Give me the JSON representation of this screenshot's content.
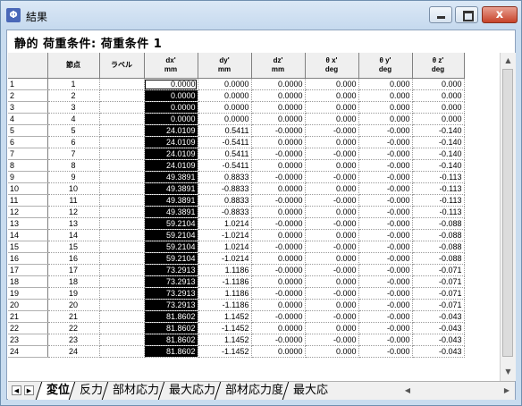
{
  "window": {
    "title": "結果",
    "icon": "app-icon",
    "close_label": "x"
  },
  "header": {
    "title": "静的 荷重条件: 荷重条件 1"
  },
  "table": {
    "columns": [
      {
        "label": "",
        "unit": ""
      },
      {
        "label": "節点",
        "unit": ""
      },
      {
        "label": "ラベル",
        "unit": ""
      },
      {
        "label": "dx'",
        "unit": "mm"
      },
      {
        "label": "dy'",
        "unit": "mm"
      },
      {
        "label": "dz'",
        "unit": "mm"
      },
      {
        "label": "θ x'",
        "unit": "deg"
      },
      {
        "label": "θ y'",
        "unit": "deg"
      },
      {
        "label": "θ z'",
        "unit": "deg"
      }
    ],
    "rows": [
      [
        "1",
        "1",
        "",
        "0.0000",
        "0.0000",
        "0.0000",
        "0.000",
        "0.000",
        "0.000"
      ],
      [
        "2",
        "2",
        "",
        "0.0000",
        "0.0000",
        "0.0000",
        "0.000",
        "0.000",
        "0.000"
      ],
      [
        "3",
        "3",
        "",
        "0.0000",
        "0.0000",
        "0.0000",
        "0.000",
        "0.000",
        "0.000"
      ],
      [
        "4",
        "4",
        "",
        "0.0000",
        "0.0000",
        "0.0000",
        "0.000",
        "0.000",
        "0.000"
      ],
      [
        "5",
        "5",
        "",
        "24.0109",
        "0.5411",
        "-0.0000",
        "-0.000",
        "-0.000",
        "-0.140"
      ],
      [
        "6",
        "6",
        "",
        "24.0109",
        "-0.5411",
        "0.0000",
        "0.000",
        "-0.000",
        "-0.140"
      ],
      [
        "7",
        "7",
        "",
        "24.0109",
        "0.5411",
        "-0.0000",
        "-0.000",
        "-0.000",
        "-0.140"
      ],
      [
        "8",
        "8",
        "",
        "24.0109",
        "-0.5411",
        "0.0000",
        "0.000",
        "-0.000",
        "-0.140"
      ],
      [
        "9",
        "9",
        "",
        "49.3891",
        "0.8833",
        "-0.0000",
        "-0.000",
        "-0.000",
        "-0.113"
      ],
      [
        "10",
        "10",
        "",
        "49.3891",
        "-0.8833",
        "0.0000",
        "0.000",
        "-0.000",
        "-0.113"
      ],
      [
        "11",
        "11",
        "",
        "49.3891",
        "0.8833",
        "-0.0000",
        "-0.000",
        "-0.000",
        "-0.113"
      ],
      [
        "12",
        "12",
        "",
        "49.3891",
        "-0.8833",
        "0.0000",
        "0.000",
        "-0.000",
        "-0.113"
      ],
      [
        "13",
        "13",
        "",
        "59.2104",
        "1.0214",
        "-0.0000",
        "-0.000",
        "-0.000",
        "-0.088"
      ],
      [
        "14",
        "14",
        "",
        "59.2104",
        "-1.0214",
        "0.0000",
        "0.000",
        "-0.000",
        "-0.088"
      ],
      [
        "15",
        "15",
        "",
        "59.2104",
        "1.0214",
        "-0.0000",
        "-0.000",
        "-0.000",
        "-0.088"
      ],
      [
        "16",
        "16",
        "",
        "59.2104",
        "-1.0214",
        "0.0000",
        "0.000",
        "-0.000",
        "-0.088"
      ],
      [
        "17",
        "17",
        "",
        "73.2913",
        "1.1186",
        "-0.0000",
        "-0.000",
        "-0.000",
        "-0.071"
      ],
      [
        "18",
        "18",
        "",
        "73.2913",
        "-1.1186",
        "0.0000",
        "0.000",
        "-0.000",
        "-0.071"
      ],
      [
        "19",
        "19",
        "",
        "73.2913",
        "1.1186",
        "-0.0000",
        "-0.000",
        "-0.000",
        "-0.071"
      ],
      [
        "20",
        "20",
        "",
        "73.2913",
        "-1.1186",
        "0.0000",
        "0.000",
        "-0.000",
        "-0.071"
      ],
      [
        "21",
        "21",
        "",
        "81.8602",
        "1.1452",
        "-0.0000",
        "-0.000",
        "-0.000",
        "-0.043"
      ],
      [
        "22",
        "22",
        "",
        "81.8602",
        "-1.1452",
        "0.0000",
        "0.000",
        "-0.000",
        "-0.043"
      ],
      [
        "23",
        "23",
        "",
        "81.8602",
        "1.1452",
        "-0.0000",
        "-0.000",
        "-0.000",
        "-0.043"
      ],
      [
        "24",
        "24",
        "",
        "81.8602",
        "-1.1452",
        "0.0000",
        "0.000",
        "-0.000",
        "-0.043"
      ]
    ]
  },
  "tabs": [
    {
      "label": "変位",
      "active": true
    },
    {
      "label": "反力",
      "active": false
    },
    {
      "label": "部材応力",
      "active": false
    },
    {
      "label": "最大応力",
      "active": false
    },
    {
      "label": "部材応力度",
      "active": false
    },
    {
      "label": "最大応",
      "active": false
    }
  ],
  "nav": {
    "prev_glyph": "◀",
    "next_glyph": "▶",
    "up_glyph": "▲",
    "down_glyph": "▼",
    "left_glyph": "◀",
    "right_glyph": "▶"
  },
  "colors": {
    "selection_bg": "#000000",
    "selection_fg": "#ffffff",
    "titlebar": "#c9dcef",
    "close_button": "#c7432a"
  }
}
